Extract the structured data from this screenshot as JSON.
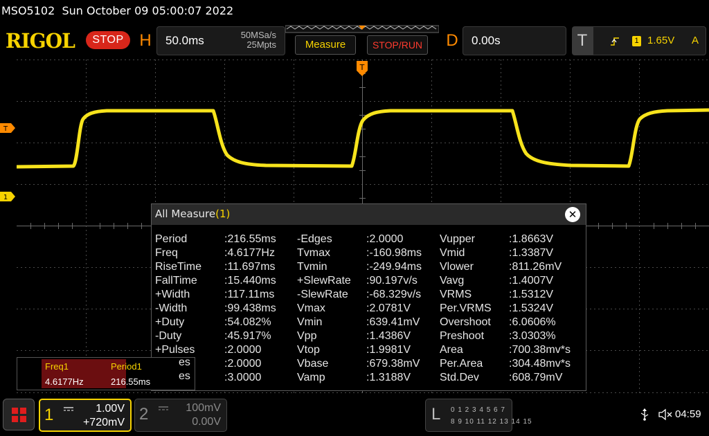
{
  "status": {
    "model": "MSO5102",
    "datetime": "Sun October 09 05:00:07 2022"
  },
  "header": {
    "logo": "RIGOL",
    "state_badge": "STOP",
    "horizontal": {
      "letter": "H",
      "timebase": "50.0ms",
      "sample_rate": "50MSa/s",
      "memory_depth": "25Mpts"
    },
    "measure_button": "Measure",
    "stoprun_button": "STOP/RUN",
    "delay": {
      "letter": "D",
      "value": "0.00s"
    },
    "trigger": {
      "letter": "T",
      "channel": "1",
      "level": "1.65V",
      "mode": "A"
    }
  },
  "markers": {
    "trigger_level": "T",
    "channel1_offset": "1",
    "trigger_position": "T"
  },
  "measure_dialog": {
    "title": "All Measure",
    "count": "(1)",
    "close_icon": "close-icon",
    "columns": [
      [
        {
          "name": "Period",
          "value": ":216.55ms"
        },
        {
          "name": "Freq",
          "value": ":4.6177Hz"
        },
        {
          "name": "RiseTime",
          "value": ":11.697ms"
        },
        {
          "name": "FallTime",
          "value": ":15.440ms"
        },
        {
          "name": "+Width",
          "value": ":117.11ms"
        },
        {
          "name": "-Width",
          "value": ":99.438ms"
        },
        {
          "name": "+Duty",
          "value": ":54.082%"
        },
        {
          "name": "-Duty",
          "value": ":45.917%"
        },
        {
          "name": "+Pulses",
          "value": ":2.0000"
        },
        {
          "name": "",
          "value": ":2.0000"
        },
        {
          "name": "",
          "value": ":3.0000"
        }
      ],
      [
        {
          "name": "-Edges",
          "value": ":2.0000"
        },
        {
          "name": "Tvmax",
          "value": ":-160.98ms"
        },
        {
          "name": "Tvmin",
          "value": ":-249.94ms"
        },
        {
          "name": "+SlewRate",
          "value": ":90.197v/s"
        },
        {
          "name": "-SlewRate",
          "value": ":-68.329v/s"
        },
        {
          "name": "Vmax",
          "value": ":2.0781V"
        },
        {
          "name": "Vmin",
          "value": ":639.41mV"
        },
        {
          "name": "Vpp",
          "value": ":1.4386V"
        },
        {
          "name": "Vtop",
          "value": ":1.9981V"
        },
        {
          "name": "Vbase",
          "value": ":679.38mV"
        },
        {
          "name": "Vamp",
          "value": ":1.3188V"
        }
      ],
      [
        {
          "name": "Vupper",
          "value": ":1.8663V"
        },
        {
          "name": "Vmid",
          "value": ":1.3387V"
        },
        {
          "name": "Vlower",
          "value": ":811.26mV"
        },
        {
          "name": "Vavg",
          "value": ":1.4007V"
        },
        {
          "name": "VRMS",
          "value": ":1.5312V"
        },
        {
          "name": "Per.VRMS",
          "value": ":1.5324V"
        },
        {
          "name": "Overshoot",
          "value": ":6.0606%"
        },
        {
          "name": "Preshoot",
          "value": ":3.0303%"
        },
        {
          "name": "Area",
          "value": ":700.38mv*s"
        },
        {
          "name": "Per.Area",
          "value": ":304.48mv*s"
        },
        {
          "name": "Std.Dev",
          "value": ":608.79mV"
        }
      ]
    ],
    "partial_labels": [
      "es",
      "es"
    ]
  },
  "stats_box": {
    "items": [
      {
        "label": "Freq1",
        "value": "4.6177Hz"
      },
      {
        "label": "Period1",
        "value": "216.55ms"
      }
    ]
  },
  "bottom": {
    "channel1": {
      "number": "1",
      "scale": "1.00V",
      "offset": "+720mV"
    },
    "channel2": {
      "number": "2",
      "scale": "100mV",
      "offset": "0.00V"
    },
    "logic": {
      "letter": "L",
      "row1": "0 1 2 3   4 5 6 7",
      "row2": "8 9 10 11  12 13 14 15"
    },
    "clock": "04:59"
  },
  "colors": {
    "channel1": "#f7d300",
    "trigger": "#ff8a00",
    "stop": "#d8261a",
    "grid": "#5a5a5a"
  },
  "icons": [
    "menu-grid-icon",
    "usb-icon",
    "speaker-mute-icon",
    "close-icon",
    "trigger-edge-icon"
  ]
}
